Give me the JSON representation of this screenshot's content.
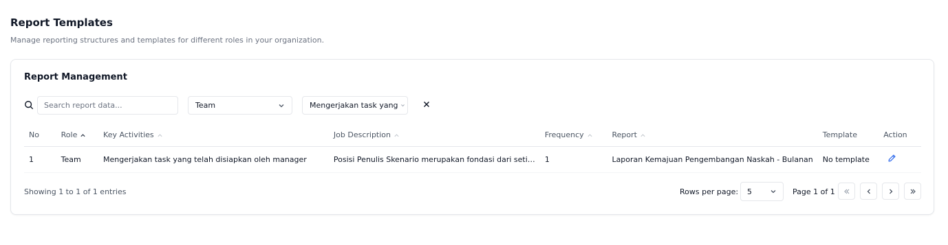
{
  "header": {
    "title": "Report Templates",
    "subtitle": "Manage reporting structures and templates for different roles in your organization."
  },
  "card": {
    "title": "Report Management",
    "search": {
      "placeholder": "Search report data...",
      "value": ""
    },
    "role_filter": {
      "value": "Team",
      "icon": "chevron-down-icon"
    },
    "activity_filter": {
      "value": "Mengerjakan task yang",
      "icon": "chevron-down-icon"
    },
    "clear_icon": "close-icon"
  },
  "table": {
    "columns": {
      "no": "No",
      "role": "Role",
      "key_activities": "Key Activities",
      "job_description": "Job Description",
      "frequency": "Frequency",
      "report": "Report",
      "template": "Template",
      "action": "Action"
    },
    "rows": [
      {
        "no": "1",
        "role": "Team",
        "key_activities": "Mengerjakan task yang telah disiapkan oleh manager",
        "job_description": "Posisi Penulis Skenario merupakan fondasi dari seti…",
        "frequency": "1",
        "report": "Laporan Kemajuan Pengembangan Naskah - Bulanan",
        "template": "No template",
        "action_icon": "pencil-icon"
      }
    ]
  },
  "footer": {
    "showing": "Showing 1 to 1 of 1 entries",
    "rows_per_page_label": "Rows per page:",
    "rows_per_page_value": "5",
    "page_info": "Page 1 of 1"
  },
  "colors": {
    "accent": "#2563eb",
    "border": "#e5e7eb",
    "muted_text": "#6b7280"
  }
}
